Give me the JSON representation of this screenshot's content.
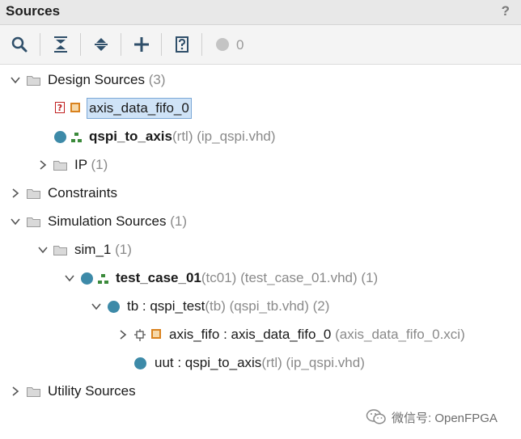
{
  "panel": {
    "title": "Sources",
    "help": "?"
  },
  "toolbar": {
    "badge_count": "0"
  },
  "tree": {
    "design_sources": {
      "label": "Design Sources",
      "count": "(3)"
    },
    "axis_data_fifo": {
      "label": "axis_data_fifo_0"
    },
    "qspi_to_axis": {
      "name": "qspi_to_axis",
      "type": "(rtl)",
      "file": "(ip_qspi.vhd)"
    },
    "ip": {
      "label": "IP",
      "count": "(1)"
    },
    "constraints": {
      "label": "Constraints"
    },
    "simulation_sources": {
      "label": "Simulation Sources",
      "count": "(1)"
    },
    "sim_1": {
      "label": "sim_1",
      "count": "(1)"
    },
    "test_case": {
      "name": "test_case_01",
      "type": "(tc01)",
      "file": "(test_case_01.vhd)",
      "count": "(1)"
    },
    "tb": {
      "name": "tb : qspi_test",
      "type": "(tb)",
      "file": "(qspi_tb.vhd)",
      "count": "(2)"
    },
    "axis_fifo": {
      "name": "axis_fifo : axis_data_fifo_0",
      "file": "(axis_data_fifo_0.xci)"
    },
    "uut": {
      "name": "uut : qspi_to_axis",
      "type": "(rtl)",
      "file": "(ip_qspi.vhd)"
    },
    "utility_sources": {
      "label": "Utility Sources"
    }
  },
  "watermark": {
    "text": "微信号: OpenFPGA"
  },
  "colors": {
    "accent_dot": "#3d8aa8",
    "ip_orange": "#d9821e",
    "selection": "#cfe3f7"
  }
}
